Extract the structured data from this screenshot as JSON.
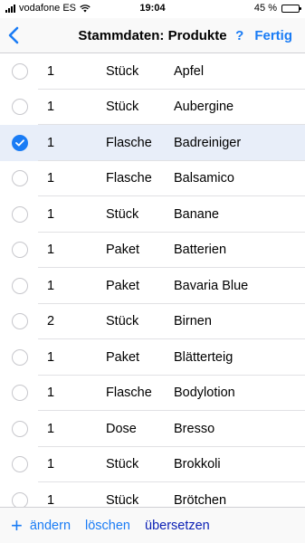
{
  "status_bar": {
    "carrier": "vodafone ES",
    "time": "19:04",
    "battery_text": "45 %",
    "battery_level": 0.45,
    "signal_icon": "signal-bars-icon",
    "wifi_icon": "wifi-icon"
  },
  "nav": {
    "back_icon": "chevron-left-icon",
    "title": "Stammdaten: Produkte",
    "help_label": "?",
    "done_label": "Fertig"
  },
  "colors": {
    "accent": "#1a7cf5",
    "selected_row": "#e8eef9",
    "translate_link": "#0a1fb5"
  },
  "products": [
    {
      "qty": "1",
      "unit": "Stück",
      "name": "Apfel",
      "selected": false
    },
    {
      "qty": "1",
      "unit": "Stück",
      "name": "Aubergine",
      "selected": false
    },
    {
      "qty": "1",
      "unit": "Flasche",
      "name": "Badreiniger",
      "selected": true
    },
    {
      "qty": "1",
      "unit": "Flasche",
      "name": "Balsamico",
      "selected": false
    },
    {
      "qty": "1",
      "unit": "Stück",
      "name": "Banane",
      "selected": false
    },
    {
      "qty": "1",
      "unit": "Paket",
      "name": "Batterien",
      "selected": false
    },
    {
      "qty": "1",
      "unit": "Paket",
      "name": "Bavaria Blue",
      "selected": false
    },
    {
      "qty": "2",
      "unit": "Stück",
      "name": "Birnen",
      "selected": false
    },
    {
      "qty": "1",
      "unit": "Paket",
      "name": "Blätterteig",
      "selected": false
    },
    {
      "qty": "1",
      "unit": "Flasche",
      "name": "Bodylotion",
      "selected": false
    },
    {
      "qty": "1",
      "unit": "Dose",
      "name": "Bresso",
      "selected": false
    },
    {
      "qty": "1",
      "unit": "Stück",
      "name": "Brokkoli",
      "selected": false
    },
    {
      "qty": "1",
      "unit": "Stück",
      "name": "Brötchen",
      "selected": false
    }
  ],
  "toolbar": {
    "add_label": "+",
    "edit_label": "ändern",
    "delete_label": "löschen",
    "translate_label": "übersetzen"
  }
}
